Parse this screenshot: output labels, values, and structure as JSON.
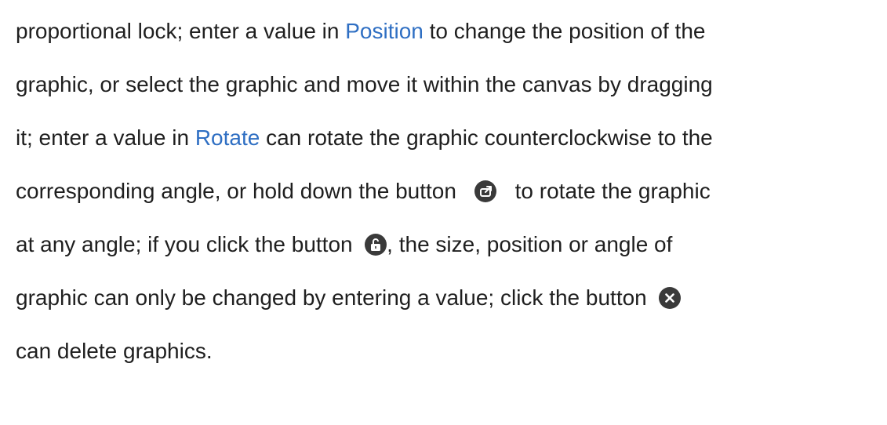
{
  "paragraph": {
    "line1": {
      "a": "proportional lock; enter a value in",
      "link": "Position",
      "b": "to change the position of the"
    },
    "line2": "graphic, or select the graphic and move it within the canvas by dragging",
    "line3": {
      "a": "it; enter a value in",
      "link": "Rotate",
      "b": "can rotate the graphic counterclockwise to the"
    },
    "line4": {
      "a": "corresponding angle, or hold down the button",
      "b": "to rotate the graphic"
    },
    "line5": {
      "a": "at any angle; if you click the button",
      "b": ", the size, position or angle of"
    },
    "line6": {
      "a": "graphic can only be changed by entering a value; click the button"
    },
    "line7": "can delete graphics."
  },
  "icons": {
    "rotate": "rotate-icon",
    "unlock": "unlock-icon",
    "close": "close-icon"
  },
  "colors": {
    "text": "#1f1f1f",
    "link": "#2f6fc3",
    "icon_bg": "#3a3a3a"
  }
}
